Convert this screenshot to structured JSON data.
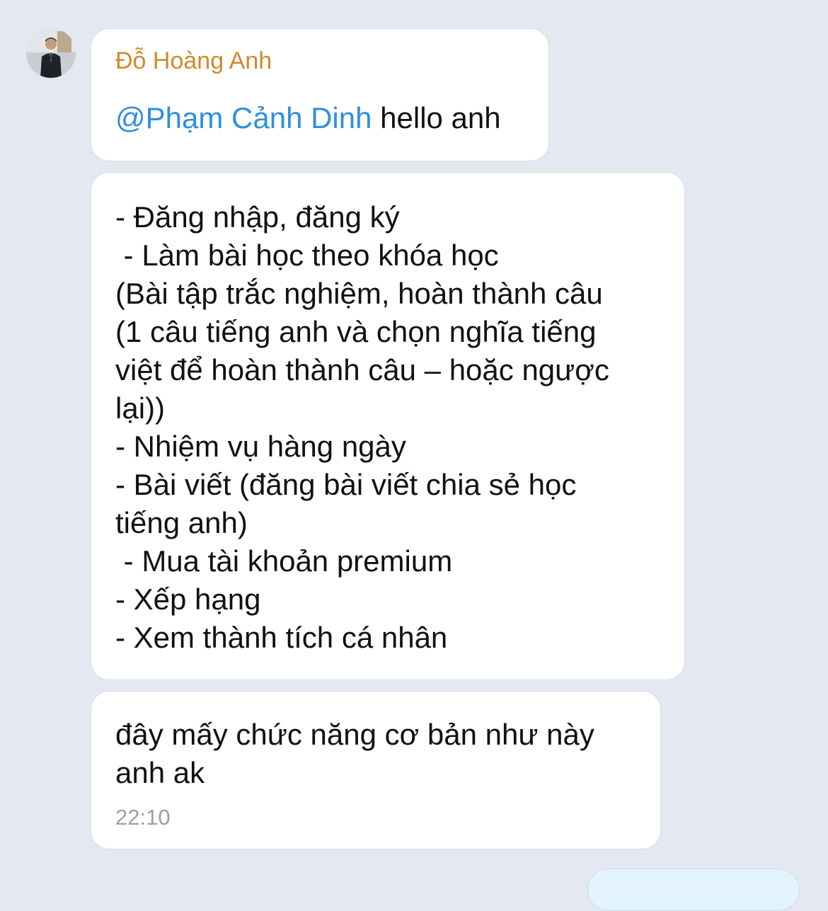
{
  "chat": {
    "messages": [
      {
        "sender": "Đỗ Hoàng Anh",
        "mention": "@Phạm Cảnh Dinh",
        "text": " hello anh"
      },
      {
        "lines": [
          "- Đăng nhập, đăng ký",
          " - Làm bài học theo khóa học",
          "(Bài tập trắc nghiệm, hoàn thành câu",
          "(1 câu tiếng anh và chọn nghĩa tiếng",
          "việt để hoàn thành câu – hoặc ngược",
          "lại))",
          "- Nhiệm vụ hàng ngày",
          "- Bài viết (đăng bài viết chia sẻ học",
          "tiếng anh)",
          " - Mua tài khoản premium",
          "- Xếp hạng",
          "- Xem thành tích cá nhân"
        ]
      },
      {
        "text": "đây mấy chức năng cơ bản như này anh ak",
        "time": "22:10"
      }
    ]
  },
  "colors": {
    "background": "#e3e8f1",
    "bubble": "#ffffff",
    "sender_name": "#d08a2a",
    "mention": "#2f8fe0",
    "timestamp": "#9aa0a8",
    "outgoing_bubble": "#e3f3fd"
  },
  "icons": {
    "avatar": "user-photo-avatar"
  }
}
